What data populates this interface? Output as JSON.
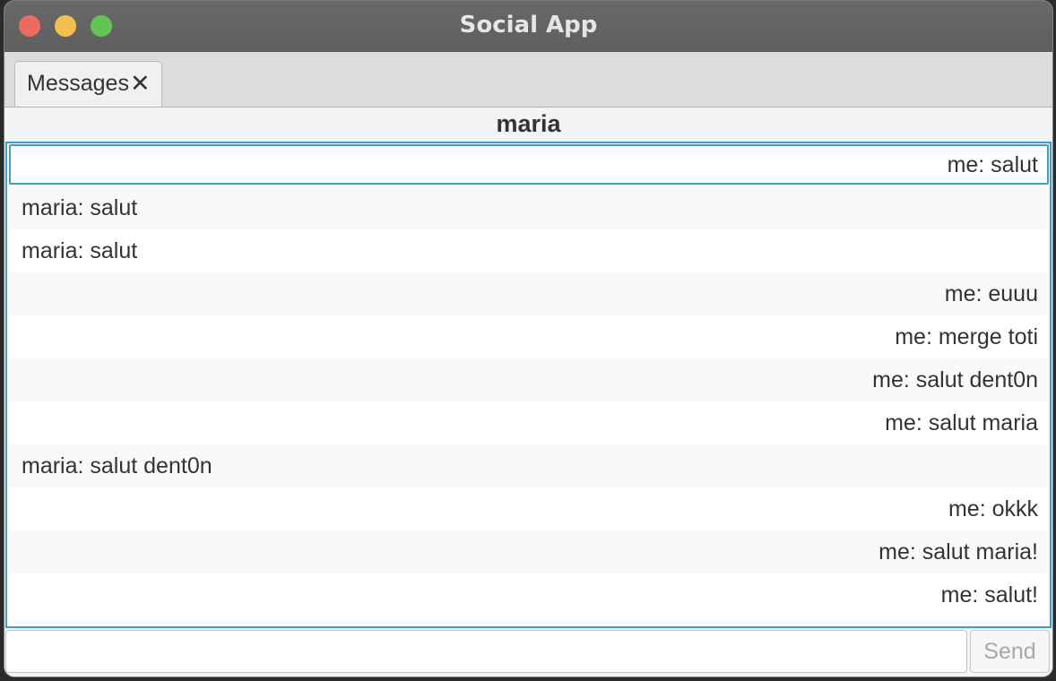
{
  "window": {
    "title": "Social App"
  },
  "tabs": [
    {
      "label": "Messages",
      "close_glyph": "✕"
    }
  ],
  "chat": {
    "contact_name": "maria",
    "messages": [
      {
        "text": "me: salut",
        "sender": "me"
      },
      {
        "text": "maria: salut",
        "sender": "maria"
      },
      {
        "text": "maria: salut",
        "sender": "maria"
      },
      {
        "text": "me: euuu",
        "sender": "me"
      },
      {
        "text": "me: merge toti",
        "sender": "me"
      },
      {
        "text": "me: salut dent0n",
        "sender": "me"
      },
      {
        "text": "me: salut maria",
        "sender": "me"
      },
      {
        "text": "maria: salut dent0n",
        "sender": "maria"
      },
      {
        "text": "me: okkk",
        "sender": "me"
      },
      {
        "text": "me: salut maria!",
        "sender": "me"
      },
      {
        "text": "me: salut!",
        "sender": "me"
      }
    ]
  },
  "composer": {
    "input_value": "",
    "send_label": "Send"
  },
  "colors": {
    "accent": "#3ba0c9",
    "close": "#ec6a5e",
    "minimize": "#f4bf4f",
    "maximize": "#61c554"
  }
}
